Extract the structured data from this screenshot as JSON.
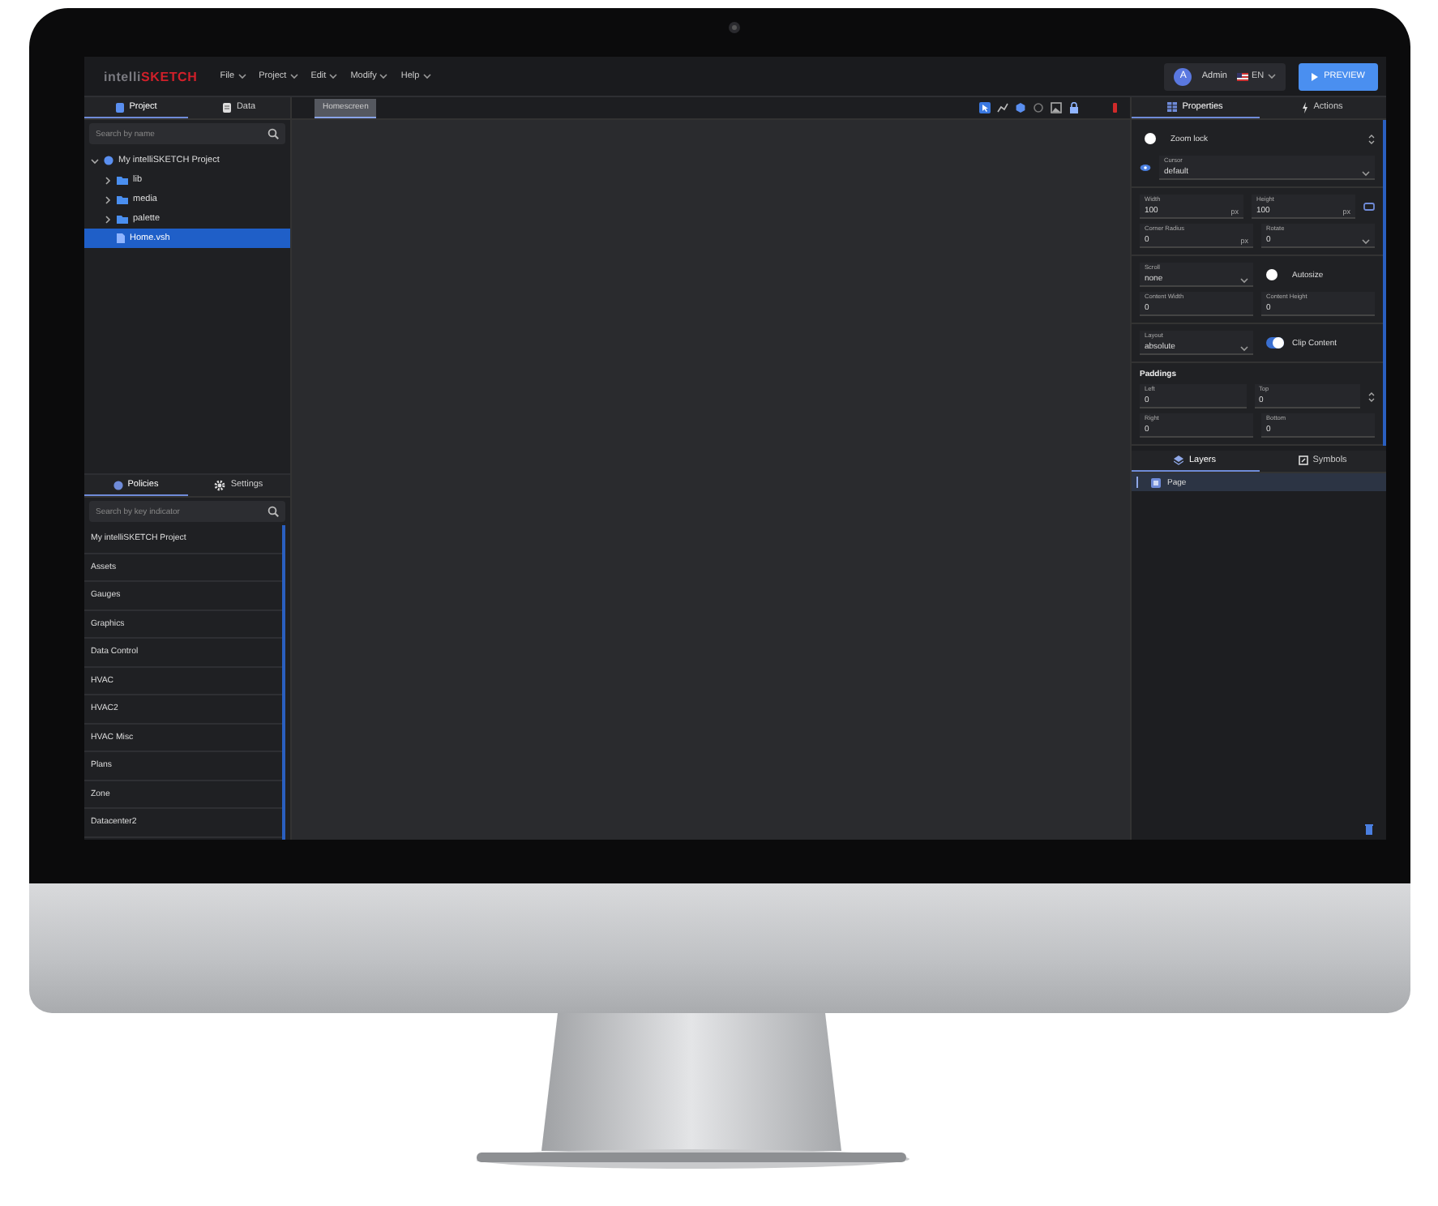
{
  "menubar": {
    "logo_prefix": "intelli",
    "logo_main": "SKETCH",
    "menus": [
      "File",
      "Project",
      "Edit",
      "Modify",
      "Help"
    ],
    "user": {
      "avatar": "A",
      "name": "Admin"
    },
    "language": "EN",
    "preview_button": "PREVIEW"
  },
  "left_panel": {
    "tabs": [
      {
        "label": "Project",
        "selected": true
      },
      {
        "label": "Data",
        "selected": false
      }
    ],
    "search": {
      "placeholder": "Search by name"
    },
    "tree": [
      {
        "label": "My intelliSKETCH Project",
        "kind": "project",
        "expanded": true,
        "selected": false,
        "children": [
          {
            "label": "lib",
            "kind": "folder",
            "expanded": false,
            "selected": false
          },
          {
            "label": "media",
            "kind": "folder",
            "expanded": false,
            "selected": false
          },
          {
            "label": "palette",
            "kind": "folder",
            "expanded": false,
            "selected": false
          },
          {
            "label": "Home.vsh",
            "kind": "file",
            "selected": true
          }
        ]
      }
    ],
    "bottom_tabs": [
      {
        "label": "Policies",
        "selected": true
      },
      {
        "label": "Settings",
        "selected": false
      }
    ],
    "bottom_search": {
      "placeholder": "Search by key indicator"
    },
    "policies": [
      "My intelliSKETCH Project",
      "Assets",
      "Gauges",
      "Graphics",
      "Data Control",
      "HVAC",
      "HVAC2",
      "HVAC Misc",
      "Plans",
      "Zone",
      "Datacenter2"
    ]
  },
  "canvas": {
    "tabs": [
      {
        "label": "Homescreen",
        "selected": true
      }
    ]
  },
  "right_panel": {
    "tabs": [
      {
        "label": "Properties",
        "selected": true
      },
      {
        "label": "Actions",
        "selected": false
      }
    ],
    "sections": [
      {
        "rows": [
          [
            {
              "kind": "toggle",
              "label": "Zoom lock",
              "on": false
            }
          ],
          [
            {
              "kind": "select",
              "label": "Cursor",
              "value": "default"
            }
          ]
        ]
      },
      {
        "rows": [
          [
            {
              "kind": "input",
              "label": "Width",
              "value": "100",
              "unit": "px"
            },
            {
              "kind": "input",
              "label": "Height",
              "value": "100",
              "unit": "px"
            }
          ],
          [
            {
              "kind": "input",
              "label": "Corner Radius",
              "value": "0",
              "unit": "px"
            },
            {
              "kind": "select",
              "label": "Rotate",
              "value": "0"
            }
          ]
        ]
      },
      {
        "rows": [
          [
            {
              "kind": "select",
              "label": "Scroll",
              "value": "none"
            },
            {
              "kind": "toggle",
              "label": "Autosize",
              "on": false
            }
          ],
          [
            {
              "kind": "input",
              "label": "Content Width",
              "value": "0"
            },
            {
              "kind": "input",
              "label": "Content Height",
              "value": "0"
            }
          ]
        ]
      },
      {
        "rows": [
          [
            {
              "kind": "select",
              "label": "Layout",
              "value": "absolute"
            },
            {
              "kind": "toggle",
              "label": "Clip Content",
              "on": true
            }
          ]
        ]
      },
      {
        "heading": "Paddings",
        "rows": [
          [
            {
              "kind": "input",
              "label": "Left",
              "value": "0"
            },
            {
              "kind": "input",
              "label": "Top",
              "value": "0"
            }
          ],
          [
            {
              "kind": "input",
              "label": "Right",
              "value": "0"
            },
            {
              "kind": "input",
              "label": "Bottom",
              "value": "0"
            }
          ]
        ]
      }
    ],
    "layer_tabs": [
      {
        "label": "Layers",
        "selected": true
      },
      {
        "label": "Symbols",
        "selected": false
      }
    ],
    "layers": [
      {
        "label": "Page",
        "selected": true
      }
    ]
  }
}
